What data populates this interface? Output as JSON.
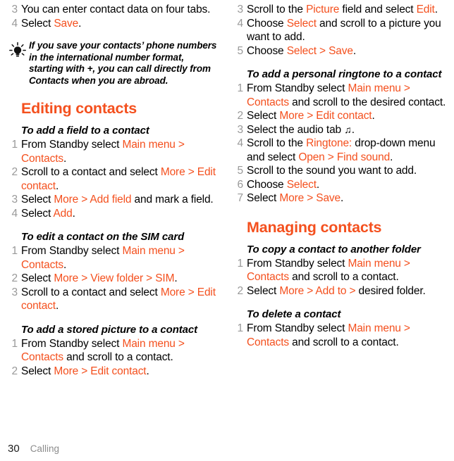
{
  "document": {
    "accent_color": "#F4501E",
    "step_number_color": "#999999",
    "body_color": "#000000",
    "background_color": "#FFFFFF"
  },
  "footer": {
    "page_number": "30",
    "chapter": "Calling"
  },
  "left_column": {
    "continued_steps": [
      {
        "num": "3",
        "parts": [
          {
            "t": "You can enter contact data on four tabs.",
            "ui": false
          }
        ]
      },
      {
        "num": "4",
        "parts": [
          {
            "t": "Select ",
            "ui": false
          },
          {
            "t": "Save",
            "ui": true
          },
          {
            "t": ".",
            "ui": false
          }
        ]
      }
    ],
    "tip": {
      "icon": "lightbulb-icon",
      "text": "If you save your contacts’ phone numbers in the international number format, starting with +, you can call directly from Contacts when you are abroad."
    },
    "heading": "Editing contacts",
    "sections": [
      {
        "title": "To add a field to a contact",
        "steps": [
          {
            "num": "1",
            "parts": [
              {
                "t": "From Standby select ",
                "ui": false
              },
              {
                "t": "Main menu > Contacts",
                "ui": true
              },
              {
                "t": ".",
                "ui": false
              }
            ]
          },
          {
            "num": "2",
            "parts": [
              {
                "t": "Scroll to a contact and select ",
                "ui": false
              },
              {
                "t": "More > Edit contact",
                "ui": true
              },
              {
                "t": ".",
                "ui": false
              }
            ]
          },
          {
            "num": "3",
            "parts": [
              {
                "t": "Select ",
                "ui": false
              },
              {
                "t": "More > Add field",
                "ui": true
              },
              {
                "t": " and mark a field.",
                "ui": false
              }
            ]
          },
          {
            "num": "4",
            "parts": [
              {
                "t": "Select ",
                "ui": false
              },
              {
                "t": "Add",
                "ui": true
              },
              {
                "t": ".",
                "ui": false
              }
            ]
          }
        ]
      },
      {
        "title": "To edit a contact on the SIM card",
        "steps": [
          {
            "num": "1",
            "parts": [
              {
                "t": "From Standby select ",
                "ui": false
              },
              {
                "t": "Main menu > Contacts",
                "ui": true
              },
              {
                "t": ".",
                "ui": false
              }
            ]
          },
          {
            "num": "2",
            "parts": [
              {
                "t": "Select ",
                "ui": false
              },
              {
                "t": "More > View folder > SIM",
                "ui": true
              },
              {
                "t": ".",
                "ui": false
              }
            ]
          },
          {
            "num": "3",
            "parts": [
              {
                "t": "Scroll to a contact and select ",
                "ui": false
              },
              {
                "t": "More > Edit contact",
                "ui": true
              },
              {
                "t": ".",
                "ui": false
              }
            ]
          }
        ]
      },
      {
        "title": "To add a stored picture to a contact",
        "steps": [
          {
            "num": "1",
            "parts": [
              {
                "t": "From Standby select ",
                "ui": false
              },
              {
                "t": "Main menu > Contacts",
                "ui": true
              },
              {
                "t": " and scroll to a contact.",
                "ui": false
              }
            ]
          },
          {
            "num": "2",
            "parts": [
              {
                "t": "Select ",
                "ui": false
              },
              {
                "t": "More > Edit contact",
                "ui": true
              },
              {
                "t": ".",
                "ui": false
              }
            ]
          }
        ]
      }
    ]
  },
  "right_column": {
    "continued_steps": [
      {
        "num": "3",
        "parts": [
          {
            "t": "Scroll to the ",
            "ui": false
          },
          {
            "t": "Picture",
            "ui": true
          },
          {
            "t": " field and select ",
            "ui": false
          },
          {
            "t": "Edit",
            "ui": true
          },
          {
            "t": ".",
            "ui": false
          }
        ]
      },
      {
        "num": "4",
        "parts": [
          {
            "t": "Choose ",
            "ui": false
          },
          {
            "t": "Select",
            "ui": true
          },
          {
            "t": " and scroll to a picture you want to add.",
            "ui": false
          }
        ]
      },
      {
        "num": "5",
        "parts": [
          {
            "t": "Choose ",
            "ui": false
          },
          {
            "t": "Select > Save",
            "ui": true
          },
          {
            "t": ".",
            "ui": false
          }
        ]
      }
    ],
    "sections_before_heading": [
      {
        "title": "To add a personal ringtone to a contact",
        "steps": [
          {
            "num": "1",
            "parts": [
              {
                "t": "From Standby select ",
                "ui": false
              },
              {
                "t": "Main menu > Contacts",
                "ui": true
              },
              {
                "t": " and scroll to the desired contact.",
                "ui": false
              }
            ]
          },
          {
            "num": "2",
            "parts": [
              {
                "t": "Select ",
                "ui": false
              },
              {
                "t": "More > Edit contact",
                "ui": true
              },
              {
                "t": ".",
                "ui": false
              }
            ]
          },
          {
            "num": "3",
            "parts": [
              {
                "t": "Select the audio tab ",
                "ui": false
              },
              {
                "t": "♫",
                "ui": false,
                "glyph": "music-note-icon"
              },
              {
                "t": ".",
                "ui": false
              }
            ]
          },
          {
            "num": "4",
            "parts": [
              {
                "t": "Scroll to the ",
                "ui": false
              },
              {
                "t": "Ringtone:",
                "ui": true
              },
              {
                "t": " drop-down menu and select ",
                "ui": false
              },
              {
                "t": "Open > Find sound",
                "ui": true
              },
              {
                "t": ".",
                "ui": false
              }
            ]
          },
          {
            "num": "5",
            "parts": [
              {
                "t": "Scroll to the sound you want to add.",
                "ui": false
              }
            ]
          },
          {
            "num": "6",
            "parts": [
              {
                "t": "Choose ",
                "ui": false
              },
              {
                "t": "Select",
                "ui": true
              },
              {
                "t": ".",
                "ui": false
              }
            ]
          },
          {
            "num": "7",
            "parts": [
              {
                "t": "Select ",
                "ui": false
              },
              {
                "t": "More > Save",
                "ui": true
              },
              {
                "t": ".",
                "ui": false
              }
            ]
          }
        ]
      }
    ],
    "heading": "Managing contacts",
    "sections": [
      {
        "title": "To copy a contact to another folder",
        "steps": [
          {
            "num": "1",
            "parts": [
              {
                "t": "From Standby select ",
                "ui": false
              },
              {
                "t": "Main menu > Contacts",
                "ui": true
              },
              {
                "t": " and scroll to a contact.",
                "ui": false
              }
            ]
          },
          {
            "num": "2",
            "parts": [
              {
                "t": "Select ",
                "ui": false
              },
              {
                "t": "More > Add to >",
                "ui": true
              },
              {
                "t": " desired folder.",
                "ui": false
              }
            ]
          }
        ]
      },
      {
        "title": "To delete a contact",
        "steps": [
          {
            "num": "1",
            "parts": [
              {
                "t": "From Standby select ",
                "ui": false
              },
              {
                "t": "Main menu > Contacts",
                "ui": true
              },
              {
                "t": " and scroll to a contact.",
                "ui": false
              }
            ]
          }
        ]
      }
    ]
  }
}
